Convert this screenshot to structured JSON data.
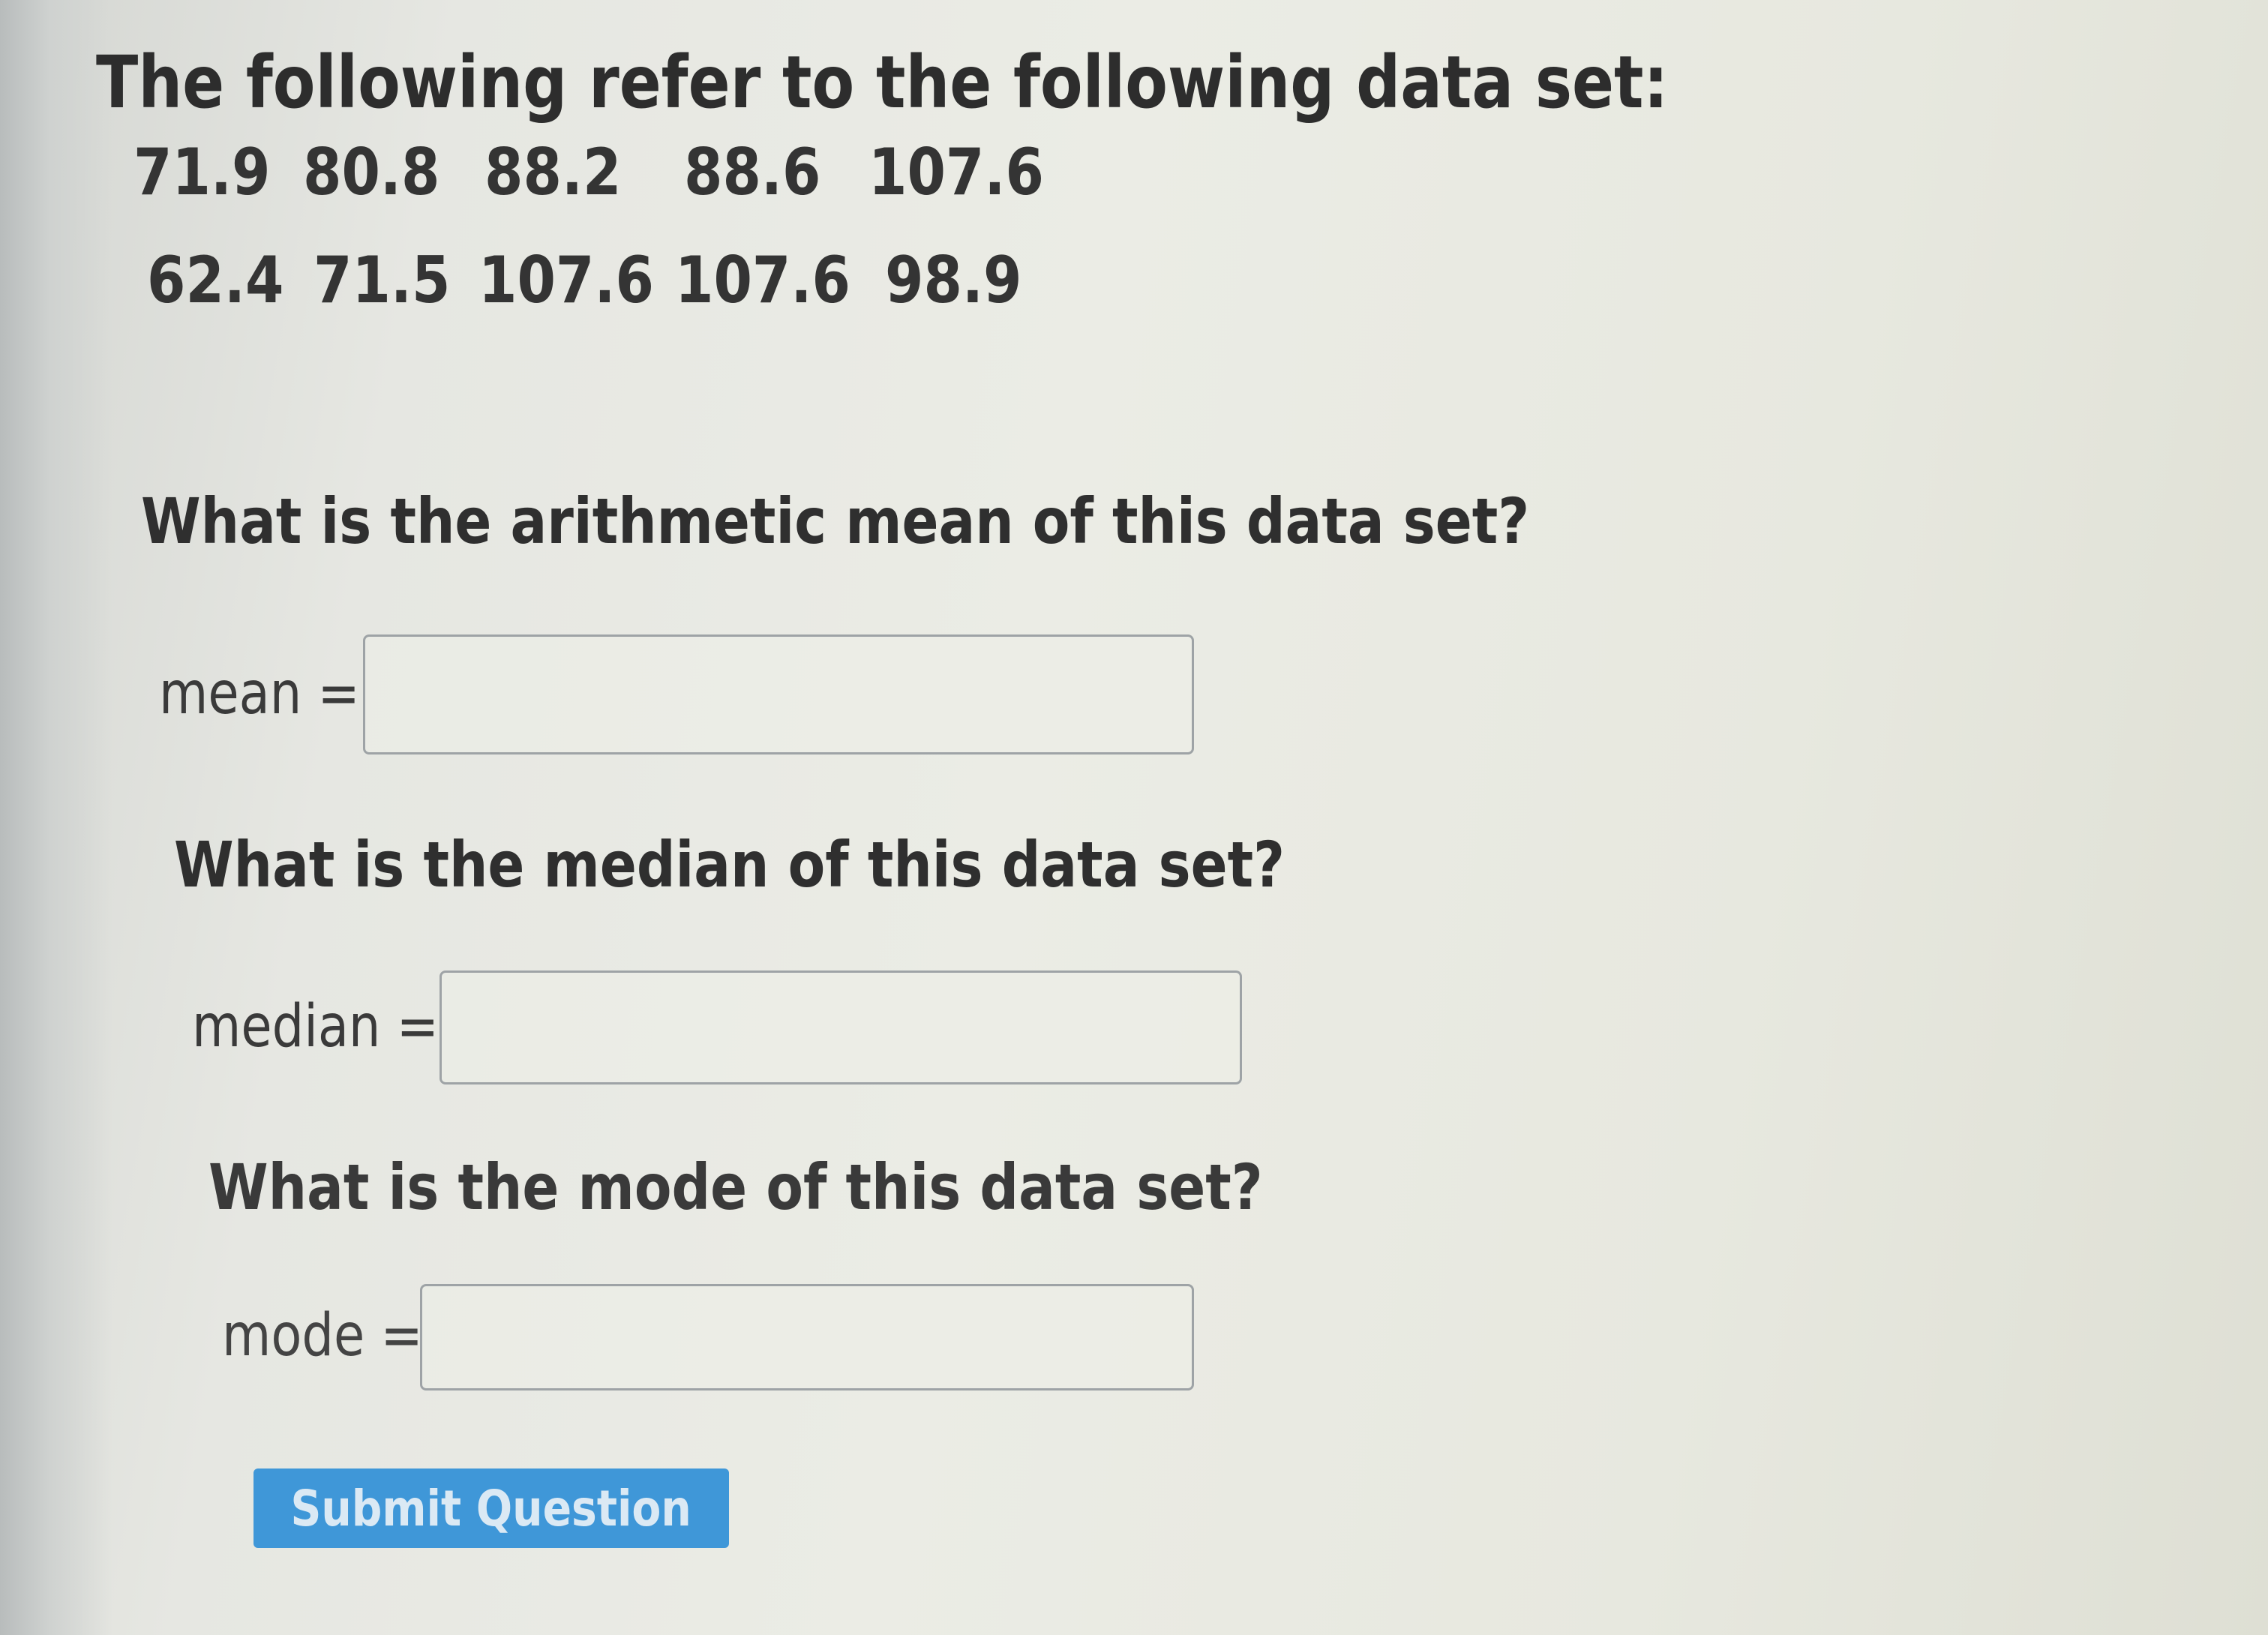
{
  "intro": "The following refer to the following data set:",
  "data_set": {
    "row1": [
      "71.9",
      "80.8",
      "88.2",
      "88.6",
      "107.6"
    ],
    "row2": [
      "62.4",
      "71.5",
      "107.6",
      "107.6",
      "98.9"
    ]
  },
  "questions": {
    "mean": {
      "prompt": "What is the arithmetic mean of this data set?",
      "label": "mean =",
      "value": ""
    },
    "median": {
      "prompt": "What is the median of this data set?",
      "label": "median =",
      "value": ""
    },
    "mode": {
      "prompt": "What is the mode of this data set?",
      "label": "mode =",
      "value": ""
    }
  },
  "submit_label": "Submit Question",
  "colors": {
    "submit_button": "#3f97d8",
    "input_border": "#9ea3a6"
  }
}
